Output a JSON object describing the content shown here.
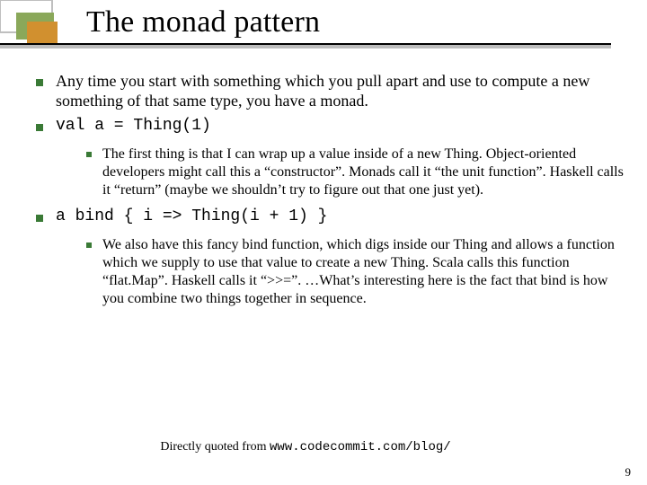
{
  "title": "The monad pattern",
  "bullets": [
    {
      "text": "Any time you start with something which you pull apart and use to compute a new something of that same type, you have a monad."
    },
    {
      "text": "val a = Thing(1)",
      "mono": true,
      "sub": [
        {
          "text": "The first thing is that I can wrap up a value inside of a new Thing. Object-oriented developers might call this a “constructor”. Monads call it “the unit function”. Haskell calls it “return” (maybe we shouldn’t try to figure out that one just yet)."
        }
      ]
    },
    {
      "text": "a bind { i => Thing(i + 1) }",
      "mono": true,
      "sub": [
        {
          "text": "We also have this fancy bind function, which digs inside our Thing and allows a function which we supply to use that value to create a new Thing. Scala calls this function “flat.Map”. Haskell calls it “>>=”. …What’s interesting here is the fact that bind is how you combine two things together in sequence."
        }
      ]
    }
  ],
  "credit_prefix": "Directly quoted from ",
  "credit_source": "www.codecommit.com/blog/",
  "page_number": "9"
}
